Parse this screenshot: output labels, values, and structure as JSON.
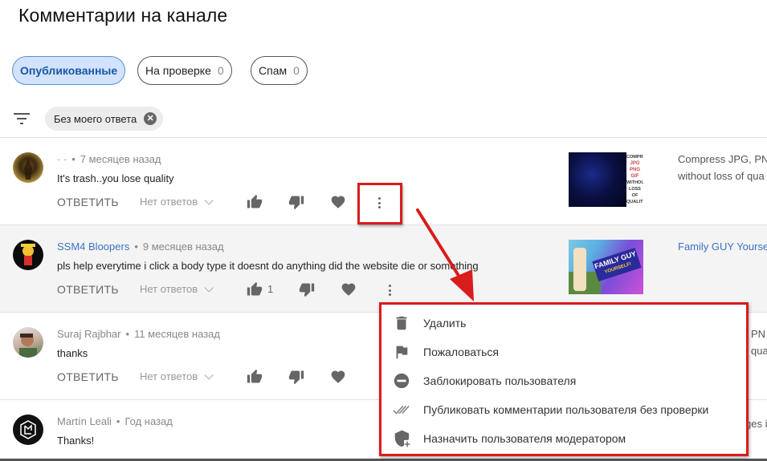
{
  "page": {
    "title": "Комментарии на канале"
  },
  "tabs": [
    {
      "label": "Опубликованные",
      "count": null,
      "active": true
    },
    {
      "label": "На проверке",
      "count": "0",
      "active": false
    },
    {
      "label": "Спам",
      "count": "0",
      "active": false
    }
  ],
  "filter": {
    "icon": "filter-icon",
    "chip_label": "Без моего ответа",
    "chip_clear_icon": "close-icon"
  },
  "comments": [
    {
      "author": "· ·",
      "time": "7 месяцев назад",
      "text": "It's trash..you lose quality",
      "reply_label": "ОТВЕТИТЬ",
      "replies_label": "Нет ответов",
      "likes": "",
      "video_title_line1": "Compress JPG, PNG",
      "video_title_line2": "without loss of qua",
      "video_thumb_text": [
        "COMPRESS",
        "JPG",
        "PNG",
        "GIF",
        "WITHOUT",
        "LOSS OF",
        "QUALITY"
      ]
    },
    {
      "author": "SSM4 Bloopers",
      "time": "9 месяцев назад",
      "text": "pls help everytime i click a body type it doesnt do anything did the website die or something",
      "reply_label": "ОТВЕТИТЬ",
      "replies_label": "Нет ответов",
      "likes": "1",
      "video_title_line1": "Family GUY Yoursel",
      "video_title_line2": "",
      "video_thumb_text": [
        "FAMILY GUY",
        "YOURSELF!"
      ]
    },
    {
      "author": "Suraj Rajbhar",
      "time": "11 месяцев назад",
      "text": "thanks",
      "reply_label": "ОТВЕТИТЬ",
      "replies_label": "Нет ответов",
      "likes": "",
      "video_title_line1": "PN",
      "video_title_line2": "qua"
    },
    {
      "author": "Martín Leali",
      "time": "Год назад",
      "text": "Thanks!",
      "video_title_line1": "ges i"
    }
  ],
  "context_menu": {
    "items": [
      {
        "icon": "trash-icon",
        "label": "Удалить"
      },
      {
        "icon": "flag-icon",
        "label": "Пожаловаться"
      },
      {
        "icon": "block-icon",
        "label": "Заблокировать пользователя"
      },
      {
        "icon": "double-check-icon",
        "label": "Публиковать комментарии пользователя без проверки"
      },
      {
        "icon": "shield-plus-icon",
        "label": "Назначить пользователя модератором"
      }
    ]
  },
  "colors": {
    "accent_red": "#d91c1c",
    "active_chip_bg": "#d3e3fd",
    "active_chip_text": "#1a57a6",
    "link_blue": "#3a73c4"
  }
}
